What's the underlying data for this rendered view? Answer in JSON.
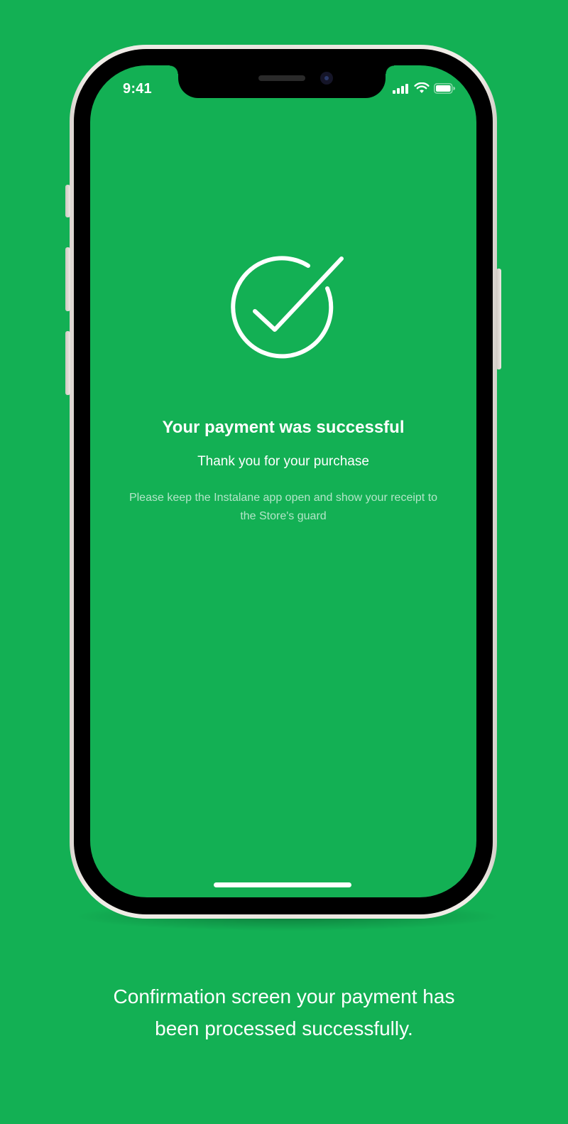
{
  "colors": {
    "background": "#13b054",
    "foreground": "#ffffff",
    "device_frame": "#ece8e3"
  },
  "status_bar": {
    "time": "9:41",
    "icons": [
      "cellular-signal-icon",
      "wifi-icon",
      "battery-icon"
    ]
  },
  "confirmation": {
    "icon": "checkmark-circle-icon",
    "title": "Your payment was successful",
    "subtitle": "Thank you for your purchase",
    "note": "Please keep the Instalane app open and show your receipt to the Store's guard"
  },
  "caption": {
    "line1": "Confirmation screen your payment has",
    "line2": "been processed successfully."
  }
}
